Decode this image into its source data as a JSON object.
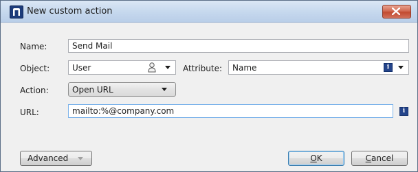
{
  "window": {
    "title": "New custom action",
    "close_icon": "close-icon"
  },
  "form": {
    "name_label": "Name:",
    "name_value": "Send Mail",
    "object_label": "Object:",
    "object_value": "User",
    "attribute_label": "Attribute:",
    "attribute_value": "Name",
    "action_label": "Action:",
    "action_value": "Open URL",
    "url_label": "URL:",
    "url_value": "mailto:%@company.com"
  },
  "buttons": {
    "advanced": "Advanced",
    "ok": "OK",
    "ok_mnemonic": "O",
    "ok_rest": "K",
    "cancel": "Cancel",
    "cancel_mnemonic": "C",
    "cancel_rest": "ancel"
  },
  "icons": {
    "info_glyph": "i"
  }
}
